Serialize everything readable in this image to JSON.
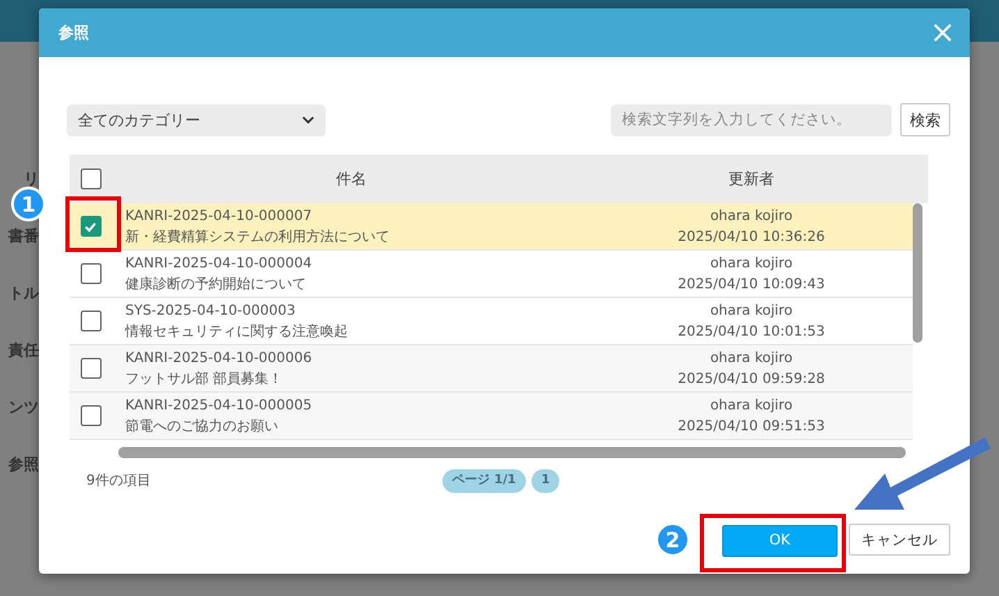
{
  "app": {
    "background_labels": [
      "リ",
      "書番",
      "トル",
      "責任",
      "ンツ",
      "参照"
    ]
  },
  "dialog": {
    "title": "参照",
    "category_select": {
      "value": "全てのカテゴリー"
    },
    "search": {
      "placeholder": "検索文字列を入力してください。",
      "button": "検索"
    },
    "table": {
      "columns": [
        "件名",
        "更新者"
      ],
      "select_all": {
        "checked": false
      },
      "rows": [
        {
          "id": "KANRI-2025-04-10-000007",
          "title": "新・経費精算システムの利用方法について",
          "updater": "ohara kojiro",
          "updated": "2025/04/10 10:36:26",
          "checked": true
        },
        {
          "id": "KANRI-2025-04-10-000004",
          "title": "健康診断の予約開始について",
          "updater": "ohara kojiro",
          "updated": "2025/04/10 10:09:43",
          "checked": false
        },
        {
          "id": "SYS-2025-04-10-000003",
          "title": "情報セキュリティに関する注意喚起",
          "updater": "ohara kojiro",
          "updated": "2025/04/10 10:01:53",
          "checked": false
        },
        {
          "id": "KANRI-2025-04-10-000006",
          "title": "フットサル部 部員募集！",
          "updater": "ohara kojiro",
          "updated": "2025/04/10 09:59:28",
          "checked": false
        },
        {
          "id": "KANRI-2025-04-10-000005",
          "title": "節電へのご協力のお願い",
          "updater": "ohara kojiro",
          "updated": "2025/04/10 09:51:53",
          "checked": false
        }
      ]
    },
    "item_count": "9件の項目",
    "pagination": {
      "page_label": "ページ 1/1",
      "pages": [
        "1"
      ]
    },
    "buttons": [
      {
        "label": "OK",
        "kind": "primary"
      },
      {
        "label": "キャンセル",
        "kind": "secondary"
      }
    ]
  },
  "annotations": [
    {
      "label": "1"
    },
    {
      "label": "2"
    }
  ]
}
